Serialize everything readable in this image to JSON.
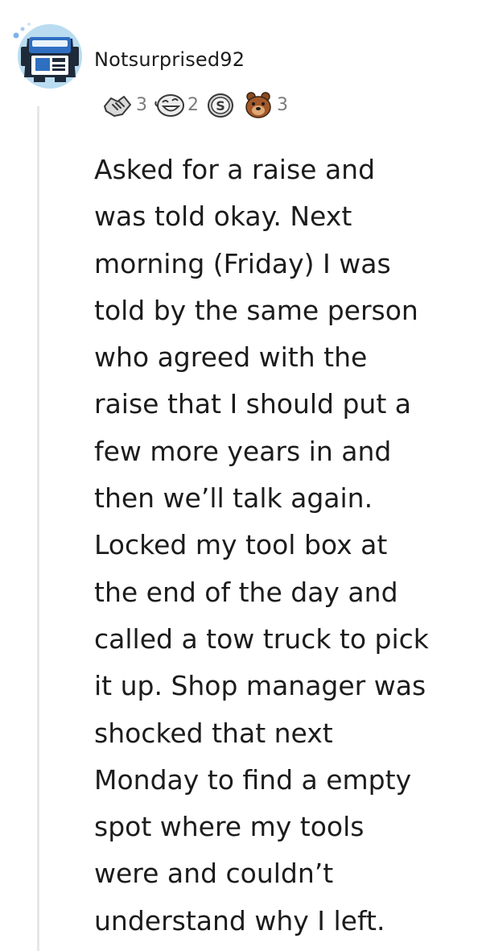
{
  "comment": {
    "author": "Notsurprised92",
    "awards": [
      {
        "icon": "handshake-award-icon",
        "count": "3"
      },
      {
        "icon": "laughing-face-award-icon",
        "count": "2"
      },
      {
        "icon": "silver-s-coin-award-icon",
        "count": ""
      },
      {
        "icon": "bear-award-icon",
        "count": "3"
      }
    ],
    "body_lines": [
      "Asked for a raise and",
      "was told okay. Next",
      "morning (Friday) I was",
      "told by the same person",
      "who agreed with the",
      "raise that I should put a",
      "few more years in and",
      "then we’ll talk again.",
      "Locked my tool box at",
      "the end of the day and",
      "called a tow truck to pick",
      "it up. Shop manager was",
      "shocked that next",
      "Monday to find a empty",
      "spot where my tools",
      "were and couldn’t",
      "understand why I left."
    ]
  },
  "colors": {
    "text": "#1c1c1c",
    "meta_text": "#7c7c7c",
    "thread_line": "#e6e6e6",
    "avatar_bg": "#b9dcf0",
    "avatar_robot": "#2f6fc1"
  }
}
